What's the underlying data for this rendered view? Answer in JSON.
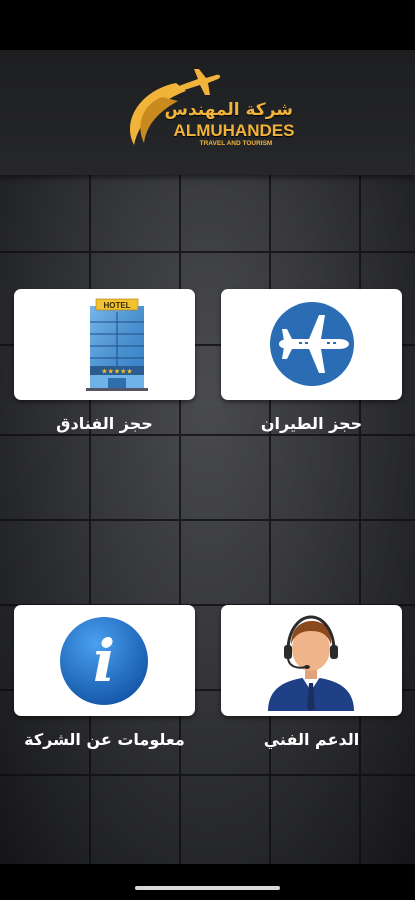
{
  "logo": {
    "arabic": "شركة المهندس",
    "name": "ALMUHANDES",
    "tagline": "TRAVEL AND TOURISM"
  },
  "menu": {
    "flights": {
      "label": "حجز الطيران",
      "icon": "airplane-icon"
    },
    "hotels": {
      "label": "حجز الفنادق",
      "icon": "hotel-building-icon",
      "sign": "HOTEL",
      "stars": "★★★★★"
    },
    "support": {
      "label": "الدعم الفني",
      "icon": "support-agent-icon"
    },
    "about": {
      "label": "معلومات عن الشركة",
      "icon": "info-icon",
      "glyph": "i"
    }
  },
  "colors": {
    "gold": "#f2b33a",
    "airplane_circle": "#2a6db4",
    "info_blue": "#1a66c4",
    "tile_bg": "#ffffff"
  }
}
